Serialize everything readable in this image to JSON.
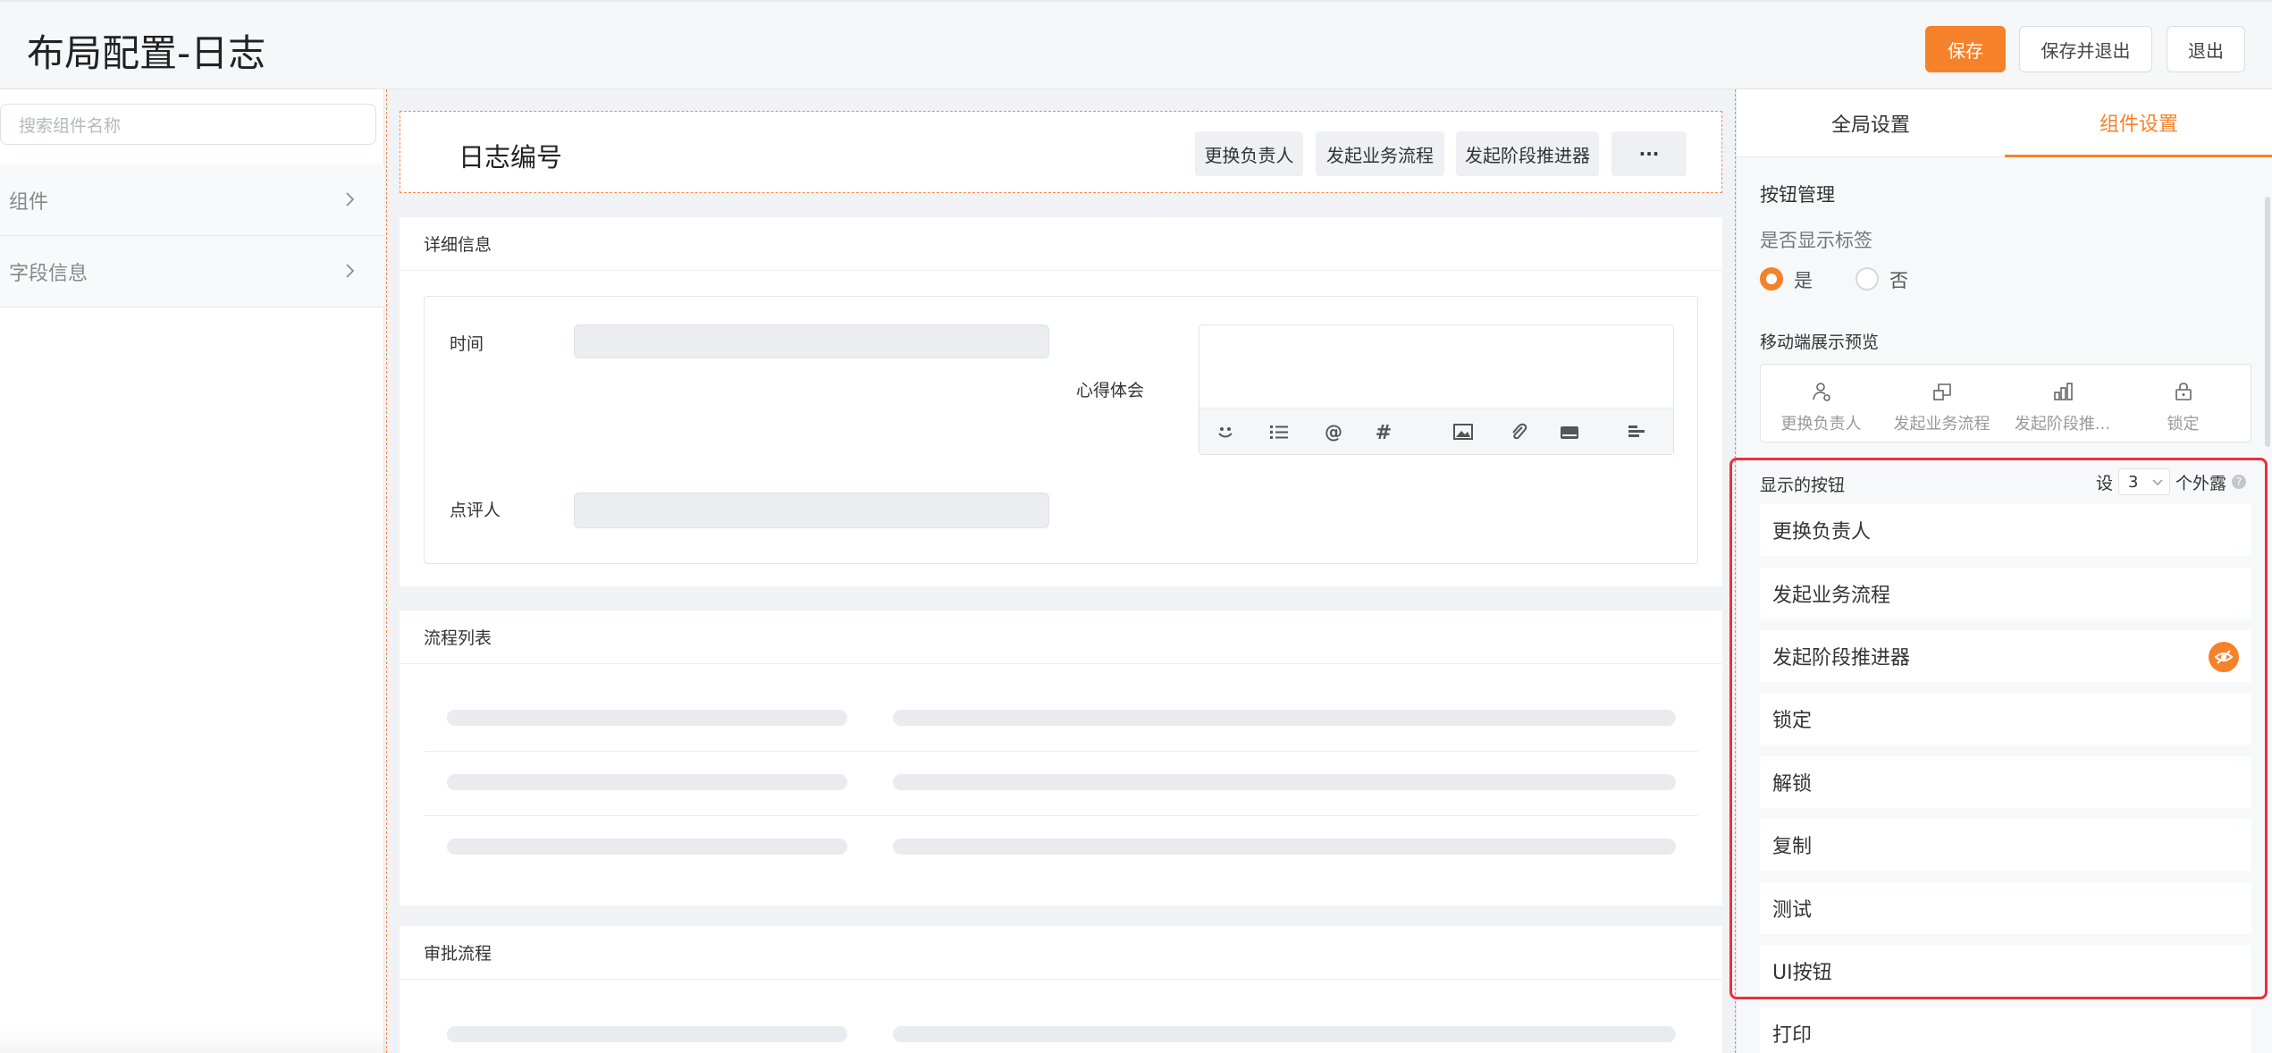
{
  "header": {
    "title": "布局配置-日志",
    "save_label": "保存",
    "save_exit_label": "保存并退出",
    "exit_label": "退出"
  },
  "left_panel": {
    "search_placeholder": "搜索组件名称",
    "items": [
      {
        "label": "组件"
      },
      {
        "label": "字段信息"
      }
    ]
  },
  "canvas": {
    "record_title": "日志编号",
    "title_buttons": [
      "更换负责人",
      "发起业务流程",
      "发起阶段推进器",
      "···"
    ],
    "detail_section": {
      "title": "详细信息",
      "fields": {
        "time_label": "时间",
        "insight_label": "心得体会",
        "reviewer_label": "点评人"
      }
    },
    "process_section": {
      "title": "流程列表"
    },
    "approval_section": {
      "title": "审批流程"
    }
  },
  "right_panel": {
    "tabs": [
      {
        "label": "全局设置",
        "active": false
      },
      {
        "label": "组件设置",
        "active": true
      }
    ],
    "button_management_title": "按钮管理",
    "show_label_question": "是否显示标签",
    "show_label_options": [
      {
        "label": "是",
        "selected": true
      },
      {
        "label": "否",
        "selected": false
      }
    ],
    "mobile_preview_title": "移动端展示预览",
    "mobile_preview_items": [
      {
        "label": "更换负责人",
        "icon": "user-swap-icon"
      },
      {
        "label": "发起业务流程",
        "icon": "flow-icon"
      },
      {
        "label": "发起阶段推...",
        "icon": "stage-chart-icon"
      },
      {
        "label": "锁定",
        "icon": "lock-icon"
      }
    ],
    "shown_buttons_title": "显示的按钮",
    "set_prefix": "设",
    "visible_count": "3",
    "set_suffix": "个外露",
    "buttons": [
      {
        "label": "更换负责人",
        "hidden": false
      },
      {
        "label": "发起业务流程",
        "hidden": false
      },
      {
        "label": "发起阶段推进器",
        "hidden": true
      },
      {
        "label": "锁定",
        "hidden": false
      },
      {
        "label": "解锁",
        "hidden": false
      },
      {
        "label": "复制",
        "hidden": false
      },
      {
        "label": "测试",
        "hidden": false
      },
      {
        "label": "UI按钮",
        "hidden": false
      },
      {
        "label": "打印",
        "hidden": false
      }
    ]
  },
  "colors": {
    "accent": "#f5822a",
    "highlight_frame": "#e8323c"
  }
}
